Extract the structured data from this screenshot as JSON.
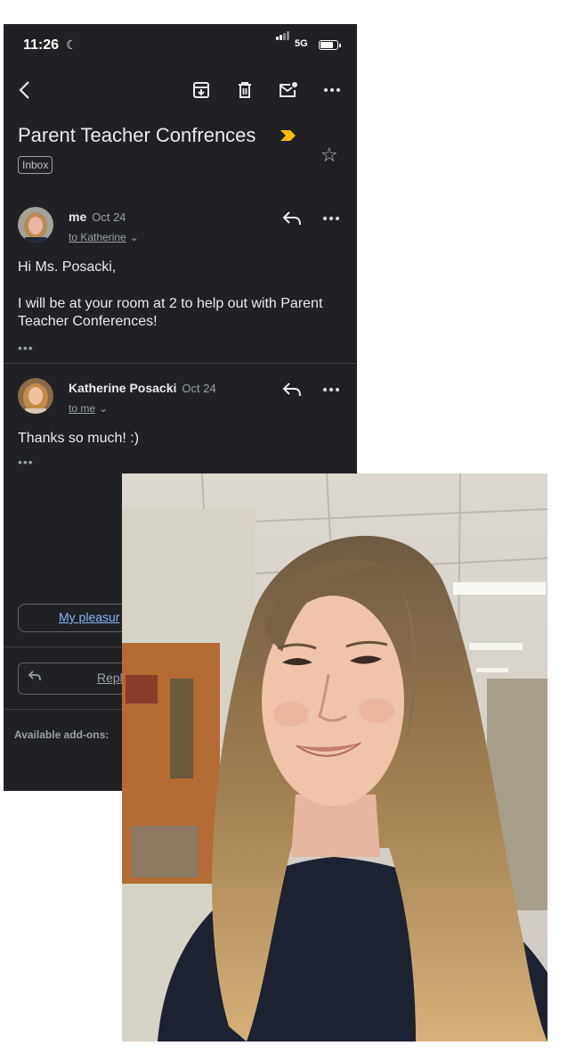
{
  "status": {
    "time": "11:26",
    "network": "5G"
  },
  "toolbar": {
    "back_icon": "back-arrow-icon",
    "archive_icon": "archive-icon",
    "delete_icon": "trash-icon",
    "unread_icon": "mark-unread-icon",
    "more_icon": "more-horizontal-icon"
  },
  "email": {
    "subject": "Parent Teacher Confrences",
    "label": "Inbox",
    "importance_color": "#fbbc04"
  },
  "messages": [
    {
      "sender": "me",
      "date": "Oct 24",
      "recipient": "to Katherine",
      "body": [
        "Hi Ms. Posacki,",
        "I will be at your room at 2 to help out with Parent Teacher Conferences!"
      ],
      "ellipsis": "•••"
    },
    {
      "sender": "Katherine Posacki",
      "date": "Oct 24",
      "recipient": "to me",
      "body": [
        "Thanks so much!  :)"
      ],
      "ellipsis": "•••"
    }
  ],
  "actions": {
    "smart_reply": "My pleasur",
    "reply": "Repl",
    "addons": "Available add-ons:"
  },
  "colors": {
    "background": "#202124",
    "text": "#e8eaed",
    "link": "#8ab4f8"
  }
}
